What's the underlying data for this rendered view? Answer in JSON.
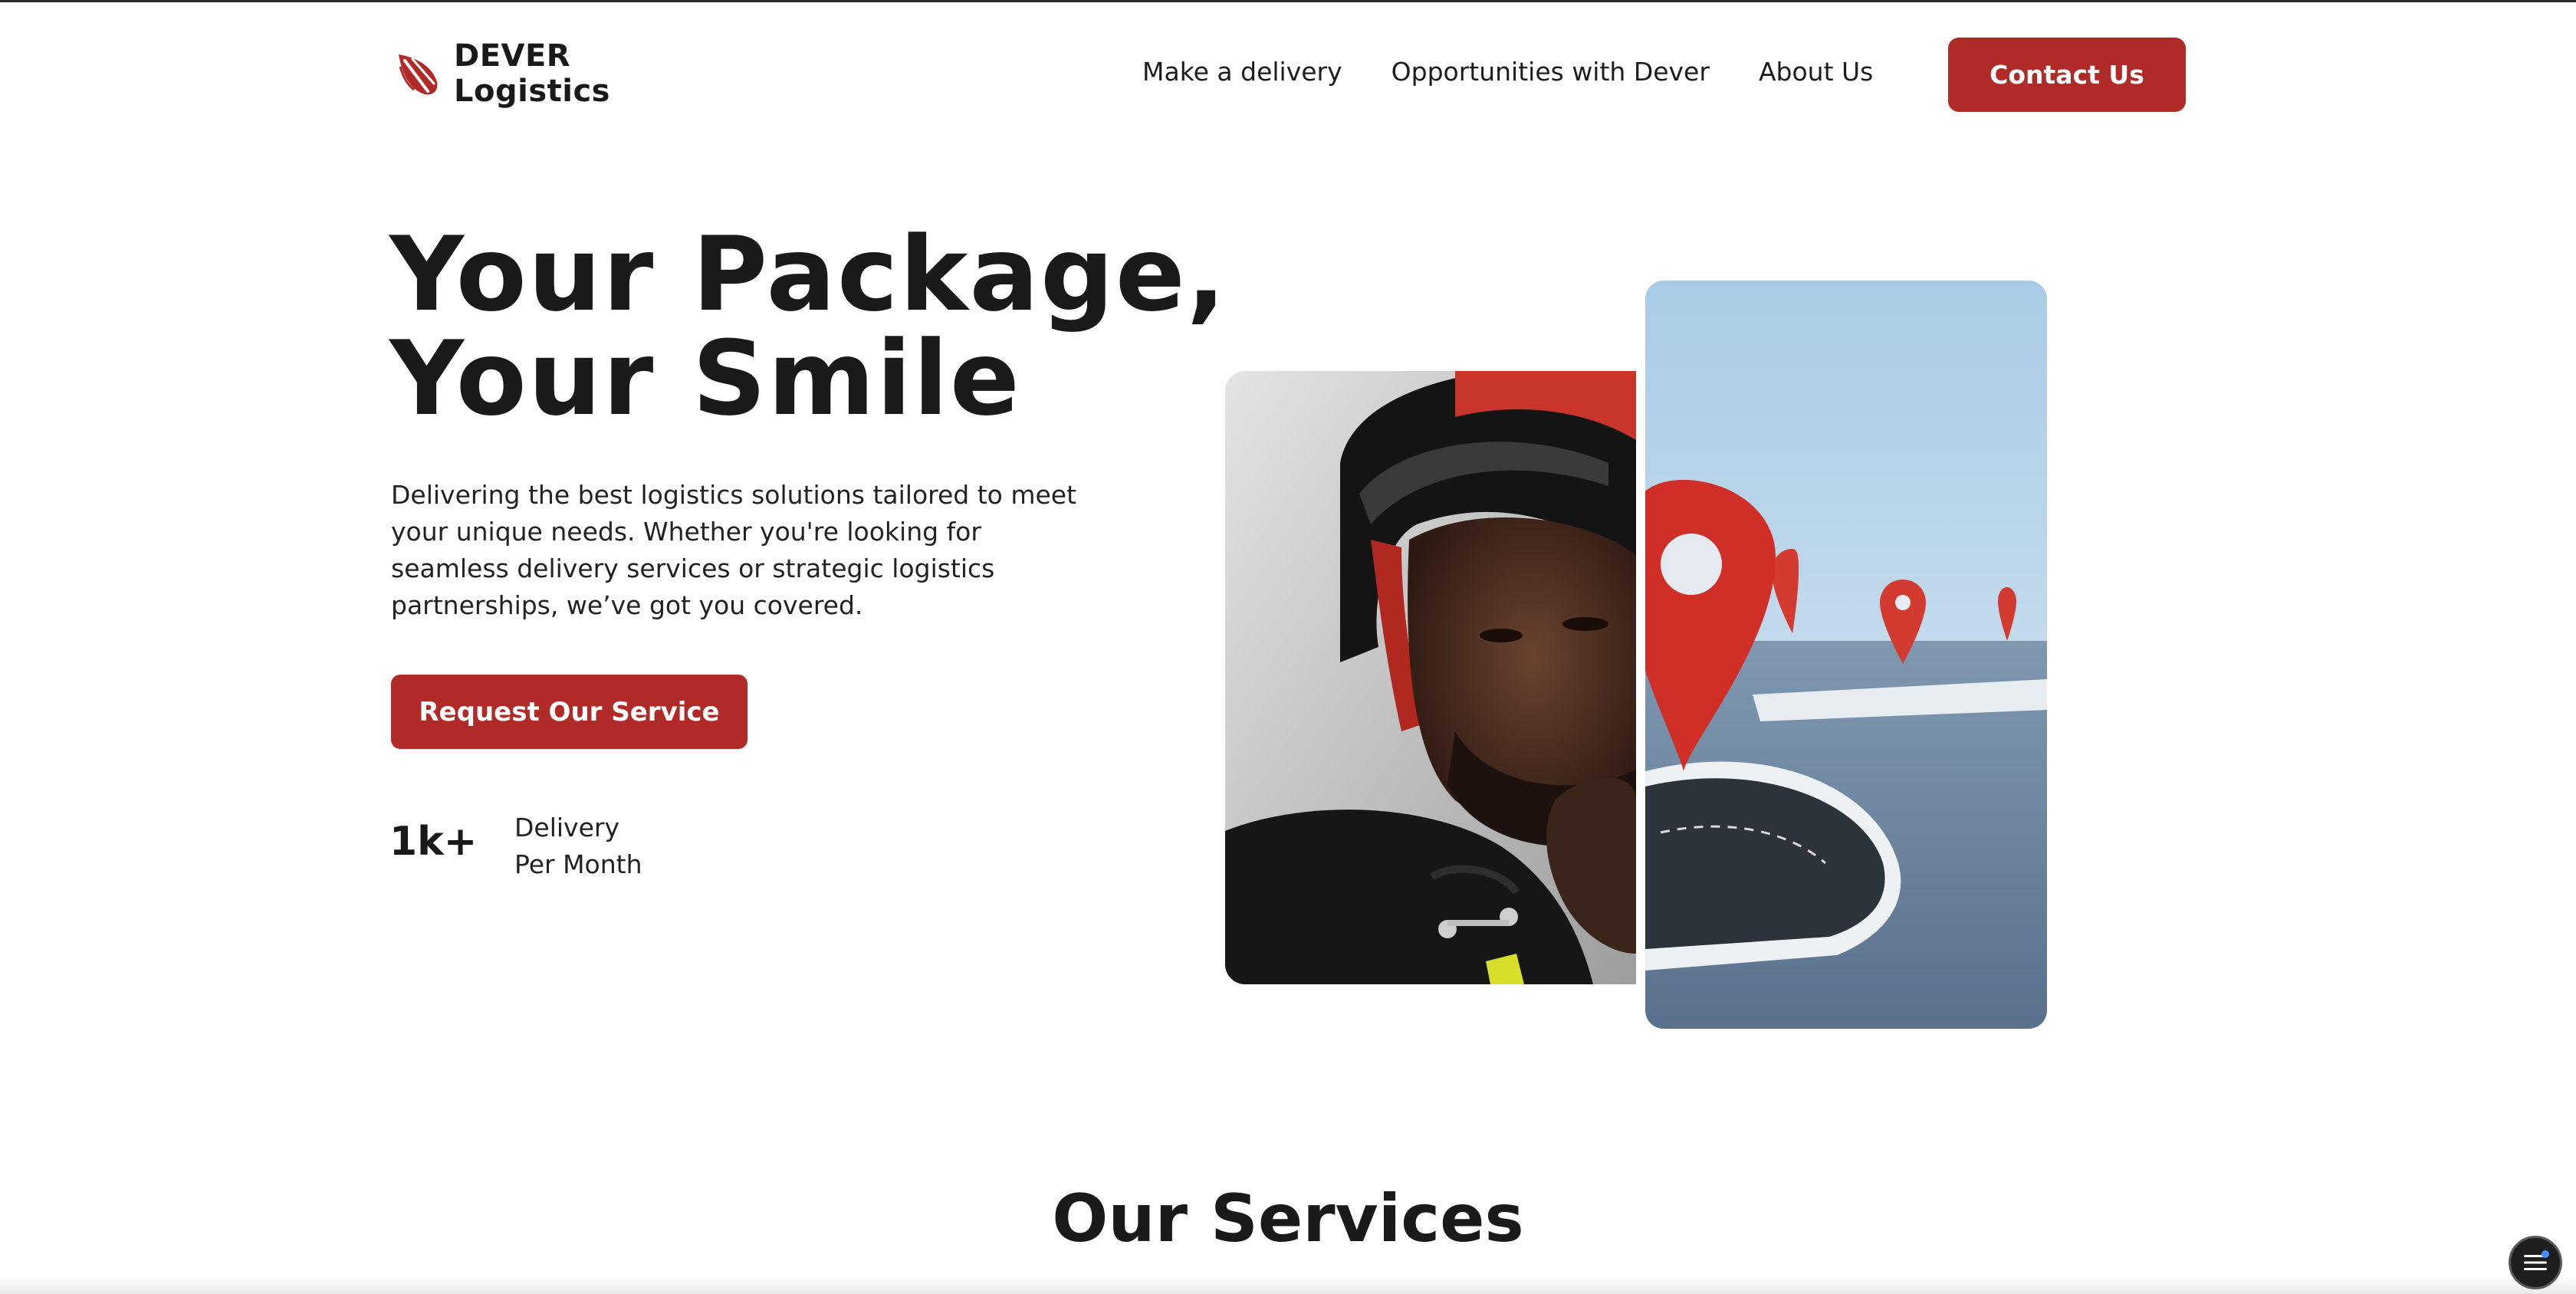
{
  "header": {
    "logo_line1": "DEVER",
    "logo_line2": "Logistics",
    "logo_icon": "dever-leaf-logo",
    "nav": [
      {
        "label": "Make a delivery"
      },
      {
        "label": "Opportunities with Dever"
      },
      {
        "label": "About Us"
      }
    ],
    "contact_label": "Contact Us"
  },
  "hero": {
    "title": "Your Package, Your Smile",
    "description": "Delivering the best logistics solutions tailored to meet your unique needs. Whether you're looking for seamless delivery services or strategic logistics partnerships, we’ve got you covered.",
    "cta_label": "Request Our Service",
    "stat": {
      "value": "1k+",
      "label_line1": "Delivery",
      "label_line2": "Per Month"
    },
    "images": [
      {
        "semantic": "courier-photo"
      },
      {
        "semantic": "map-pin-road-photo"
      }
    ]
  },
  "services": {
    "title": "Our Services"
  },
  "widget": {
    "icon": "menu-icon"
  },
  "colors": {
    "brand_red": "#b02a27",
    "text_dark": "#1a1a1a",
    "background": "#ffffff"
  }
}
